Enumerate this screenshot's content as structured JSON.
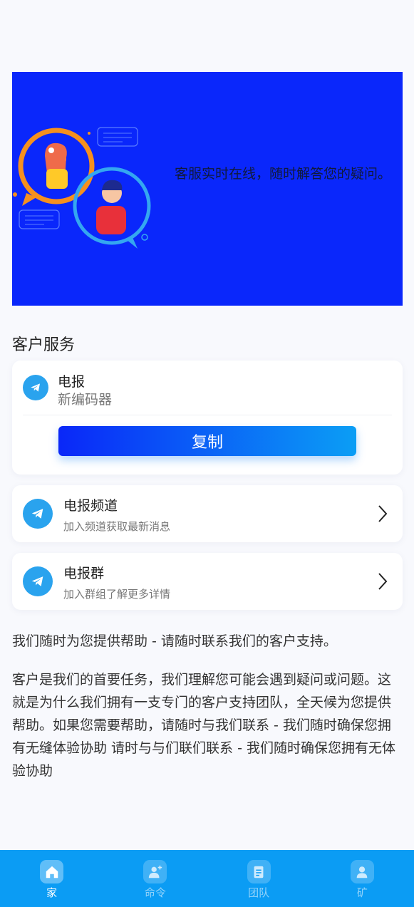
{
  "banner": {
    "text": "客服实时在线，随时解答您的疑问。"
  },
  "section_title": "客户服务",
  "contact_card": {
    "icon": "telegram-icon",
    "title": "电报",
    "subtitle": "新编码器",
    "copy_label": "复制"
  },
  "links": [
    {
      "icon": "telegram-icon",
      "title": "电报频道",
      "subtitle": "加入频道获取最新消息"
    },
    {
      "icon": "telegram-icon",
      "title": "电报群",
      "subtitle": "加入群组了解更多详情"
    }
  ],
  "paragraphs": {
    "p1": "我们随时为您提供帮助 - 请随时联系我们的客户支持。",
    "p2": "客户是我们的首要任务，我们理解您可能会遇到疑问或问题。这就是为什么我们拥有一支专门的客户支持团队，全天候为您提供帮助。如果您需要帮助，请随时与我们联系 - 我们随时确保您拥有无缝体验协助    请时与与们联们联系 - 我们随时确保您拥有无体验协助"
  },
  "tabbar": {
    "items": [
      {
        "label": "家",
        "icon": "home-icon",
        "active": true
      },
      {
        "label": "命令",
        "icon": "add-user-icon",
        "active": false
      },
      {
        "label": "团队",
        "icon": "document-icon",
        "active": false
      },
      {
        "label": "矿",
        "icon": "user-icon",
        "active": false
      }
    ]
  },
  "colors": {
    "banner_bg": "#0a27fb",
    "tabbar_bg": "#0b9cf4",
    "telegram": "#2aa3ee",
    "button_gradient_start": "#0a27f8",
    "button_gradient_end": "#0b9ef5"
  }
}
